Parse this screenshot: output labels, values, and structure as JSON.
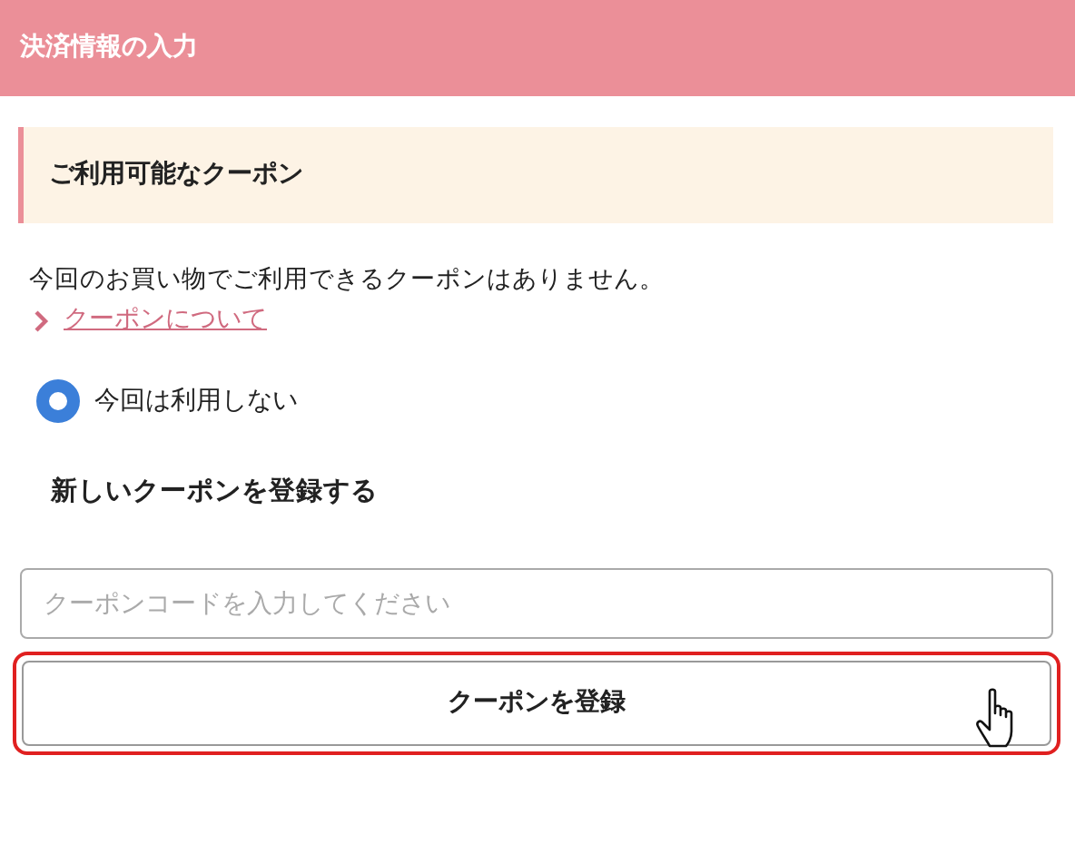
{
  "header": {
    "title": "決済情報の入力"
  },
  "coupon_section": {
    "title": "ご利用可能なクーポン"
  },
  "message": "今回のお買い物でご利用できるクーポンはありません。",
  "link": {
    "label": "クーポンについて"
  },
  "options": [
    {
      "label": "今回は利用しない",
      "selected": true
    }
  ],
  "register": {
    "heading": "新しいクーポンを登録する",
    "field": {
      "placeholder": "クーポンコードを入力してください"
    },
    "button": {
      "label": "クーポンを登録",
      "focused": true
    }
  }
}
